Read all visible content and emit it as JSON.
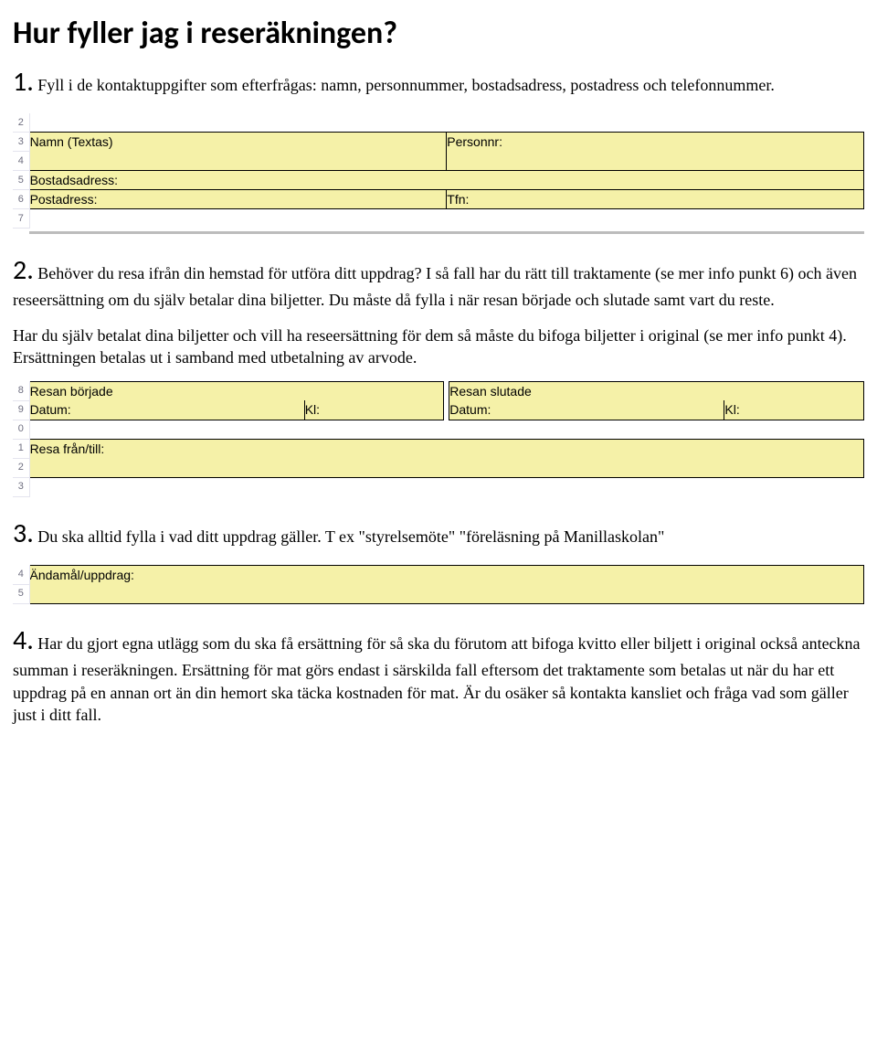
{
  "title": "Hur fyller jag i reseräkningen?",
  "p1": {
    "num": "1.",
    "text": " Fyll i de kontaktuppgifter som efterfrågas: namn, personnummer, bostadsadress, postadress och telefonnummer."
  },
  "table1": {
    "rows": [
      "2",
      "3",
      "4",
      "5",
      "6",
      "7"
    ],
    "namn": "Namn (Textas)",
    "personnr": "Personnr:",
    "bostad": "Bostadsadress:",
    "post": "Postadress:",
    "tfn": "Tfn:"
  },
  "p2": {
    "num": "2.",
    "text_a": " Behöver du resa ifrån din hemstad för utföra ditt uppdrag? I så fall har du rätt till traktamente (se mer info punkt 6) och även reseersättning om du själv betalar dina biljetter. Du måste då fylla i när resan började och slutade samt vart du reste.",
    "text_b": "Har du själv betalat dina biljetter och vill ha reseersättning för dem så måste du bifoga biljetter i original (se mer info punkt 4). Ersättningen betalas ut i samband med utbetalning av arvode."
  },
  "table2": {
    "rows": [
      "8",
      "9",
      "0",
      "1",
      "2",
      "3"
    ],
    "borjade": "Resan började",
    "slutade": "Resan slutade",
    "datum": "Datum:",
    "kl": "Kl:",
    "resafran": "Resa från/till:"
  },
  "p3": {
    "num": "3.",
    "text": " Du ska alltid fylla i vad ditt uppdrag gäller. T ex \"styrelsemöte\" \"föreläsning på Manillaskolan\""
  },
  "table3": {
    "rows": [
      "4",
      "5"
    ],
    "andamal": "Ändamål/uppdrag:"
  },
  "p4": {
    "num": "4.",
    "text": " Har du gjort egna utlägg som du ska få ersättning för så ska du förutom att bifoga kvitto eller biljett i original också anteckna summan i reseräkningen. Ersättning för mat görs endast i särskilda fall eftersom det traktamente som betalas ut när du har ett uppdrag på en annan ort än din hemort ska täcka kostnaden för mat. Är du osäker så kontakta kansliet och fråga vad som gäller just i ditt fall."
  }
}
